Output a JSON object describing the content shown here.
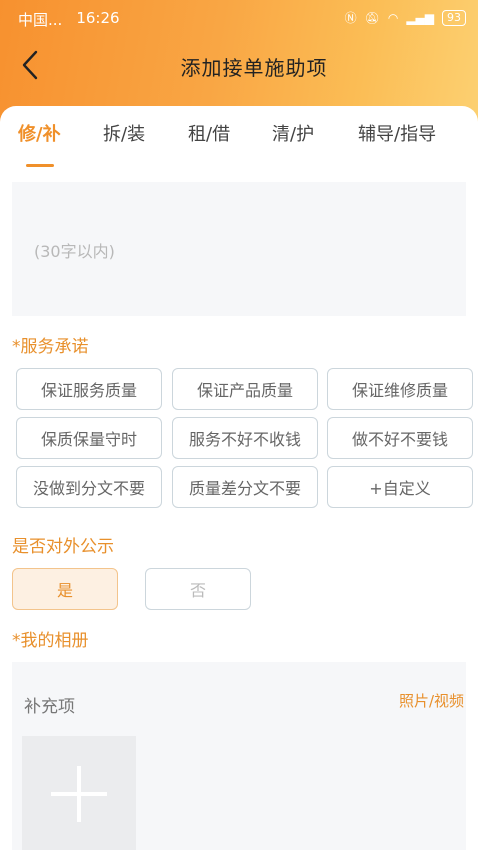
{
  "status": {
    "carrier": "中国...",
    "time": "16:26",
    "battery": "93"
  },
  "nav": {
    "title": "添加接单施助项"
  },
  "tabs": [
    {
      "label": "修/补"
    },
    {
      "label": "拆/装"
    },
    {
      "label": "租/借"
    },
    {
      "label": "清/护"
    },
    {
      "label": "辅导/指导"
    }
  ],
  "description": {
    "placeholder": "(30字以内)"
  },
  "service_promise": {
    "label": "*服务承诺",
    "options": [
      "保证服务质量",
      "保证产品质量",
      "保证维修质量",
      "保质保量守时",
      "服务不好不收钱",
      "做不好不要钱",
      "没做到分文不要",
      "质量差分文不要",
      "+自定义"
    ]
  },
  "public": {
    "label": "是否对外公示",
    "yes": "是",
    "no": "否",
    "selected": "是"
  },
  "album": {
    "label": "*我的相册",
    "supplement_label": "补充项",
    "type_label": "照片/视频"
  },
  "colors": {
    "accent": "#f0902a",
    "header_start": "#f7912f",
    "header_end": "#fcd071"
  }
}
